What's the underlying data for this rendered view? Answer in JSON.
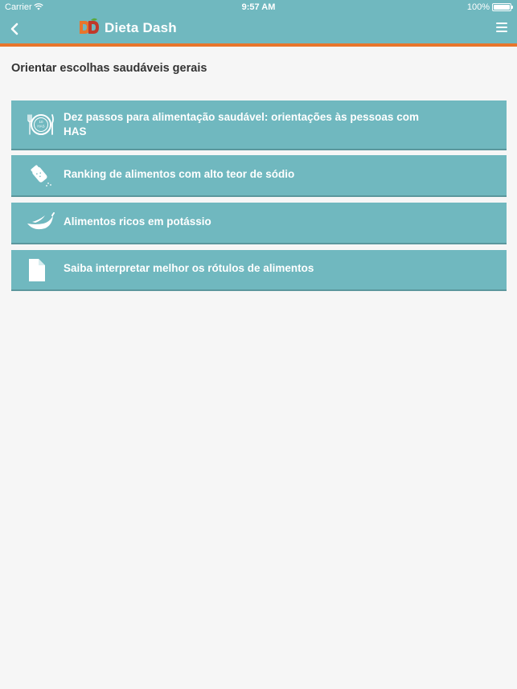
{
  "status_bar": {
    "carrier": "Carrier",
    "time": "9:57 AM",
    "battery": "100%"
  },
  "header": {
    "app_name": "Dieta Dash",
    "back_icon": "chevron-left-icon",
    "menu_icon": "hamburger-menu-icon",
    "logo_icon": "dieta-dash-logo",
    "colors": {
      "bar": "#70b8bf",
      "accent": "#e8752c"
    }
  },
  "main": {
    "section_title": "Orientar escolhas saudáveis gerais",
    "items": [
      {
        "label": "Dez passos para alimentação saudável: orientações às pessoas com HAS",
        "icon": "plate-cutlery-icon",
        "icon_text": "10 HAS"
      },
      {
        "label": "Ranking de alimentos com alto teor de sódio",
        "icon": "salt-shaker-icon"
      },
      {
        "label": "Alimentos ricos em potássio",
        "icon": "banana-icon"
      },
      {
        "label": "Saiba interpretar melhor os rótulos de alimentos",
        "icon": "document-icon"
      }
    ]
  }
}
